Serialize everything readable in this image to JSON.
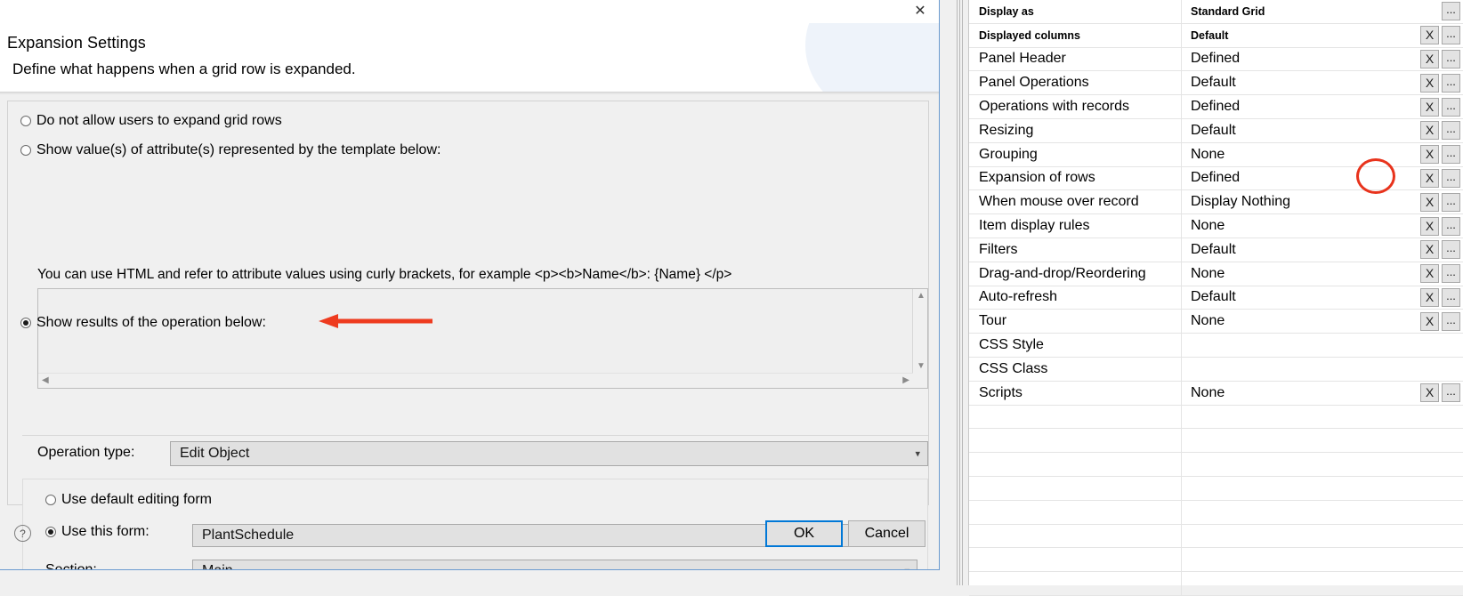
{
  "dialog": {
    "icon": "wizard-icon",
    "close_label": "✕",
    "title": "Expansion Settings",
    "subtitle": "Define what happens when a grid row is expanded.",
    "options": [
      {
        "label": "Do not allow users to expand grid rows",
        "selected": false
      },
      {
        "label": "Show value(s) of attribute(s) represented by the template below:",
        "selected": false
      },
      {
        "label": "Show results of the operation below:",
        "selected": true
      }
    ],
    "template_hint": "You can use HTML and refer to attribute values using curly brackets, for example <p><b>Name</b>: {Name} </p>",
    "template_value": "",
    "operation_type_label": "Operation type:",
    "operation_type_value": "Edit Object",
    "form_options": [
      {
        "label": "Use default editing form",
        "selected": false
      },
      {
        "label": "Use this form:",
        "selected": true
      }
    ],
    "form_value": "PlantSchedule",
    "section_label": "Section:",
    "section_value": "Main",
    "help_icon": "question-mark-icon",
    "ok_label": "OK",
    "cancel_label": "Cancel",
    "annotation_arrow_color": "#ee3b1f"
  },
  "properties_grid": {
    "annotation_ellipse_color": "#e8331c",
    "rows": [
      {
        "name": "Display as",
        "value": "Standard Grid",
        "clear": false,
        "more": true,
        "small": true
      },
      {
        "name": "Displayed columns",
        "value": "Default",
        "clear": true,
        "more": true,
        "small": true
      },
      {
        "name": "Panel Header",
        "value": "Defined",
        "clear": true,
        "more": true,
        "small": false
      },
      {
        "name": "Panel Operations",
        "value": "Default",
        "clear": true,
        "more": true,
        "small": false
      },
      {
        "name": "Operations with records",
        "value": "Defined",
        "clear": true,
        "more": true,
        "small": false
      },
      {
        "name": "Resizing",
        "value": "Default",
        "clear": true,
        "more": true,
        "small": false
      },
      {
        "name": "Grouping",
        "value": "None",
        "clear": true,
        "more": true,
        "small": false
      },
      {
        "name": "Expansion of rows",
        "value": "Defined",
        "clear": true,
        "more": true,
        "small": false
      },
      {
        "name": "When mouse over record",
        "value": "Display Nothing",
        "clear": true,
        "more": true,
        "small": false
      },
      {
        "name": "Item display rules",
        "value": "None",
        "clear": true,
        "more": true,
        "small": false
      },
      {
        "name": "Filters",
        "value": "Default",
        "clear": true,
        "more": true,
        "small": false
      },
      {
        "name": "Drag-and-drop/Reordering",
        "value": "None",
        "clear": true,
        "more": true,
        "small": false
      },
      {
        "name": "Auto-refresh",
        "value": "Default",
        "clear": true,
        "more": true,
        "small": false
      },
      {
        "name": "Tour",
        "value": "None",
        "clear": true,
        "more": true,
        "small": false
      },
      {
        "name": "CSS Style",
        "value": "",
        "clear": false,
        "more": false,
        "small": false
      },
      {
        "name": "CSS Class",
        "value": "",
        "clear": false,
        "more": false,
        "small": false
      },
      {
        "name": "Scripts",
        "value": "None",
        "clear": true,
        "more": true,
        "small": false
      },
      {
        "name": "",
        "value": "",
        "clear": false,
        "more": false,
        "small": false
      },
      {
        "name": "",
        "value": "",
        "clear": false,
        "more": false,
        "small": false
      },
      {
        "name": "",
        "value": "",
        "clear": false,
        "more": false,
        "small": false
      },
      {
        "name": "",
        "value": "",
        "clear": false,
        "more": false,
        "small": false
      },
      {
        "name": "",
        "value": "",
        "clear": false,
        "more": false,
        "small": false
      },
      {
        "name": "",
        "value": "",
        "clear": false,
        "more": false,
        "small": false
      },
      {
        "name": "",
        "value": "",
        "clear": false,
        "more": false,
        "small": false
      },
      {
        "name": "",
        "value": "",
        "clear": false,
        "more": false,
        "small": false
      }
    ],
    "clear_label": "X",
    "more_label": "..."
  }
}
